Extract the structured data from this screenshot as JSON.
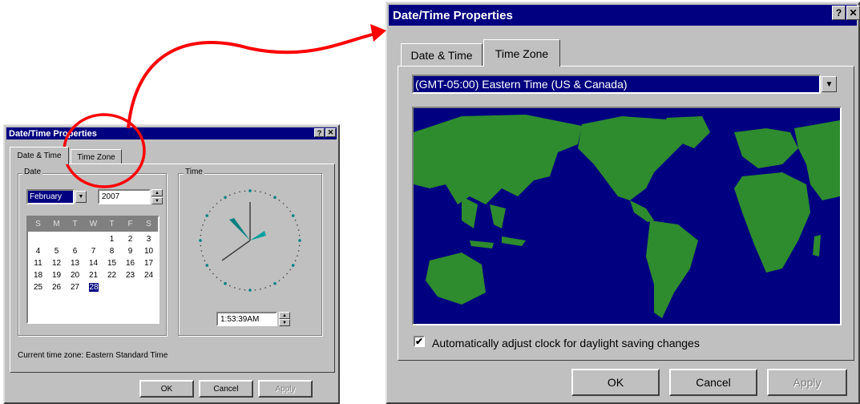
{
  "small_dialog": {
    "title": "Date/Time Properties",
    "help_btn": "?",
    "close_btn": "✕",
    "tabs": [
      "Date & Time",
      "Time Zone"
    ],
    "date_group_label": "Date",
    "time_group_label": "Time",
    "month_value": "February",
    "year_value": "2007",
    "calendar": {
      "weekday_headers": [
        "S",
        "M",
        "T",
        "W",
        "T",
        "F",
        "S"
      ],
      "rows": [
        [
          "",
          "",
          "",
          "",
          "1",
          "2",
          "3"
        ],
        [
          "4",
          "5",
          "6",
          "7",
          "8",
          "9",
          "10"
        ],
        [
          "11",
          "12",
          "13",
          "14",
          "15",
          "16",
          "17"
        ],
        [
          "18",
          "19",
          "20",
          "21",
          "22",
          "23",
          "24"
        ],
        [
          "25",
          "26",
          "27",
          "28",
          "",
          "",
          ""
        ]
      ],
      "selected_day": "28"
    },
    "time_value": "1:53:39AM",
    "current_time_zone": "Current time zone:  Eastern Standard Time",
    "buttons": {
      "ok": "OK",
      "cancel": "Cancel",
      "apply": "Apply"
    }
  },
  "large_dialog": {
    "title": "Date/Time Properties",
    "help_btn": "?",
    "close_btn": "✕",
    "tabs": [
      "Date & Time",
      "Time Zone"
    ],
    "timezone_value": "(GMT-05:00) Eastern Time (US & Canada)",
    "daylight_label": "Automatically adjust clock for daylight saving changes",
    "daylight_checked": "✔",
    "buttons": {
      "ok": "OK",
      "cancel": "Cancel",
      "apply": "Apply"
    }
  },
  "colors": {
    "titlebar": "#000080",
    "face": "#c0c0c0",
    "map_ocean": "#000080",
    "map_land": "#2e8b2e",
    "annotation": "#ff0000"
  }
}
